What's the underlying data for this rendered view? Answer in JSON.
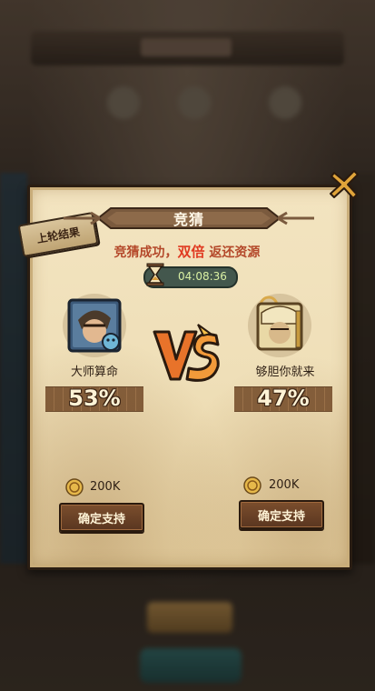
{
  "panel": {
    "title": "竞猜",
    "last_round_label": "上轮结果",
    "reward": {
      "part1": "竞猜成功，",
      "highlight": "双倍",
      "part2": " 返还资源"
    },
    "timer": "04:08:36"
  },
  "left_player": {
    "name": "大师算命",
    "percent": "53%",
    "cost": "200K",
    "button": "确定支持"
  },
  "right_player": {
    "name": "够胆你就来",
    "percent": "47%",
    "cost": "200K",
    "button": "确定支持"
  },
  "colors": {
    "accent_red": "#e03a21",
    "text_brown": "#b4482a",
    "vs_orange": "#e8732a"
  },
  "icons": [
    "close-icon",
    "hourglass-icon",
    "coin-icon",
    "vs-emblem"
  ]
}
